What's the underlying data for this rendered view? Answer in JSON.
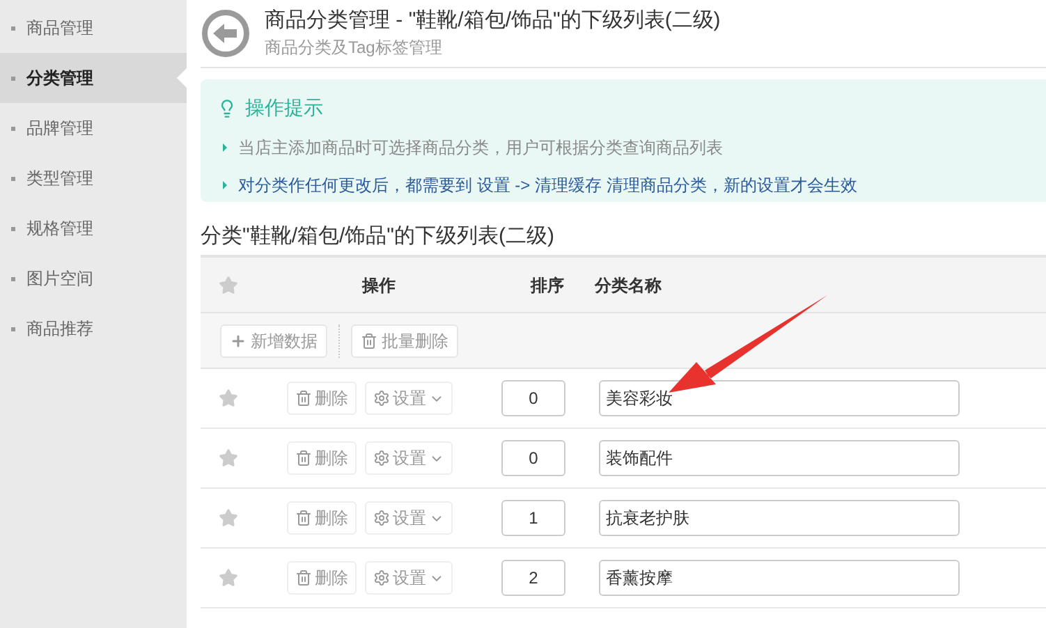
{
  "sidebar": {
    "items": [
      {
        "label": "商品管理",
        "selected": false
      },
      {
        "label": "分类管理",
        "selected": true
      },
      {
        "label": "品牌管理",
        "selected": false
      },
      {
        "label": "类型管理",
        "selected": false
      },
      {
        "label": "规格管理",
        "selected": false
      },
      {
        "label": "图片空间",
        "selected": false
      },
      {
        "label": "商品推荐",
        "selected": false
      }
    ]
  },
  "header": {
    "title": "商品分类管理 - \"鞋靴/箱包/饰品\"的下级列表(二级)",
    "subtitle": "商品分类及Tag标签管理"
  },
  "tips": {
    "title": "操作提示",
    "items": [
      {
        "text": "当店主添加商品时可选择商品分类，用户可根据分类查询商品列表",
        "kind": "plain"
      },
      {
        "text": "对分类作任何更改后，都需要到 设置 -> 清理缓存 清理商品分类，新的设置才会生效",
        "kind": "link"
      }
    ]
  },
  "section_title": "分类\"鞋靴/箱包/饰品\"的下级列表(二级)",
  "table": {
    "columns": [
      "操作",
      "排序",
      "分类名称"
    ],
    "toolbar": [
      "新增数据",
      "批量删除"
    ],
    "rows": [
      {
        "delete": "删除",
        "settings": "设置",
        "sort": "0",
        "name": "美容彩妆"
      },
      {
        "delete": "删除",
        "settings": "设置",
        "sort": "0",
        "name": "装饰配件"
      },
      {
        "delete": "删除",
        "settings": "设置",
        "sort": "1",
        "name": "抗衰老护肤"
      },
      {
        "delete": "删除",
        "settings": "设置",
        "sort": "2",
        "name": "香薰按摩"
      }
    ]
  }
}
